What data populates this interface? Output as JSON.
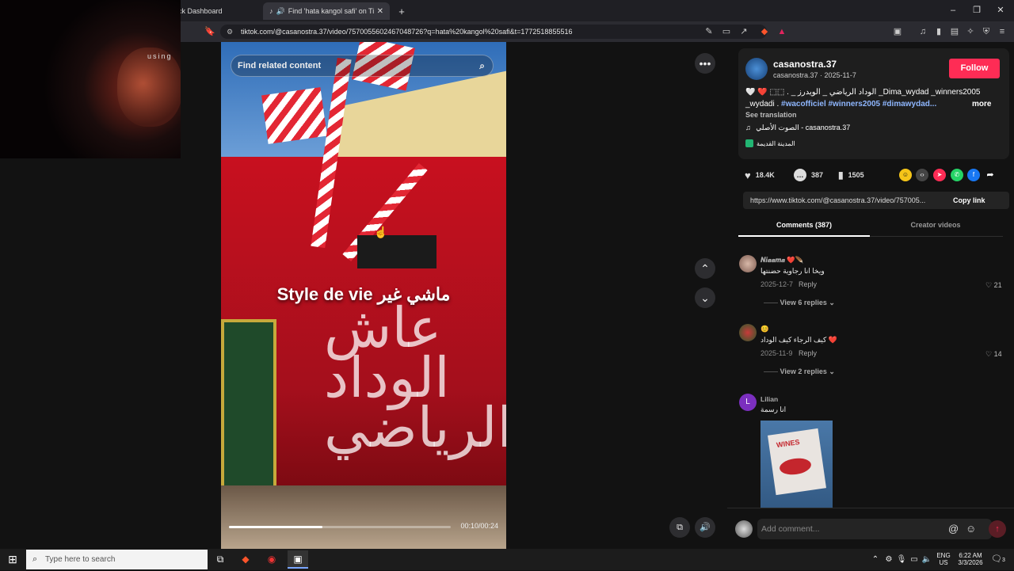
{
  "browser": {
    "tabs": [
      {
        "label": "ick Dashboard"
      },
      {
        "label": "Find 'hata kangol safi' on TikT"
      }
    ],
    "url": "tiktok.com/@casanostra.37/video/7570055602467048726?q=hata%20kangol%20safi&t=1772518855516"
  },
  "webcam": {
    "overlay_text": "using"
  },
  "video": {
    "search_placeholder": "Find related content",
    "caption": "Style de vie ماشي غير",
    "graffiti": "عاش الوداد الرياضي",
    "time": "00:10/00:24",
    "progress": 0.42
  },
  "post": {
    "username": "casanostra.37",
    "subline": "casanostra.37 · 2025-11-7",
    "follow_label": "Follow",
    "description_line1": "🤍 ❤️ ⬚⬚ . _ الوداد الرياضي _ الويدرز _Dima_wydad _winners2005",
    "description_line2_plain": "_wydadi .",
    "description_line2_tags": "#wacofficiel #winners2005 #dimawydad...",
    "more": "more",
    "see_translation": "See translation",
    "music": "الصوت الأصلي - casanostra.37",
    "location": "المدينة القديمة",
    "likes": "18.4K",
    "comments": "387",
    "saves": "1505",
    "link": "https://www.tiktok.com/@casanostra.37/video/757005...",
    "copy_link": "Copy link"
  },
  "tabs": {
    "comments": "Comments (387)",
    "creator": "Creator videos"
  },
  "comments": [
    {
      "name": "𝑵𝒊𝒂𝒂𝒎𝒂 ❤️🪶",
      "text": "ويخا انا رجاوية حضنتها",
      "date": "2025-12-7",
      "reply": "Reply",
      "likes": "21",
      "view_replies": "View 6 replies"
    },
    {
      "name": "😊",
      "text": "كيف الرجاء كيف الوداد ❤️",
      "date": "2025-11-9",
      "reply": "Reply",
      "likes": "14",
      "view_replies": "View 2 replies"
    },
    {
      "name": "Lilian",
      "avatar_letter": "L",
      "text": "انا رسمة",
      "image_text": "WINES"
    }
  ],
  "add_comment_placeholder": "Add comment...",
  "taskbar": {
    "search_placeholder": "Type here to search",
    "lang": "ENG",
    "lang_region": "US",
    "time": "6:22 AM",
    "date": "3/3/2026",
    "notification_count": "3"
  },
  "colors": {
    "follow": "#fe2c55",
    "hashtag": "#8fb7ff",
    "video_red": "#c8101f"
  }
}
